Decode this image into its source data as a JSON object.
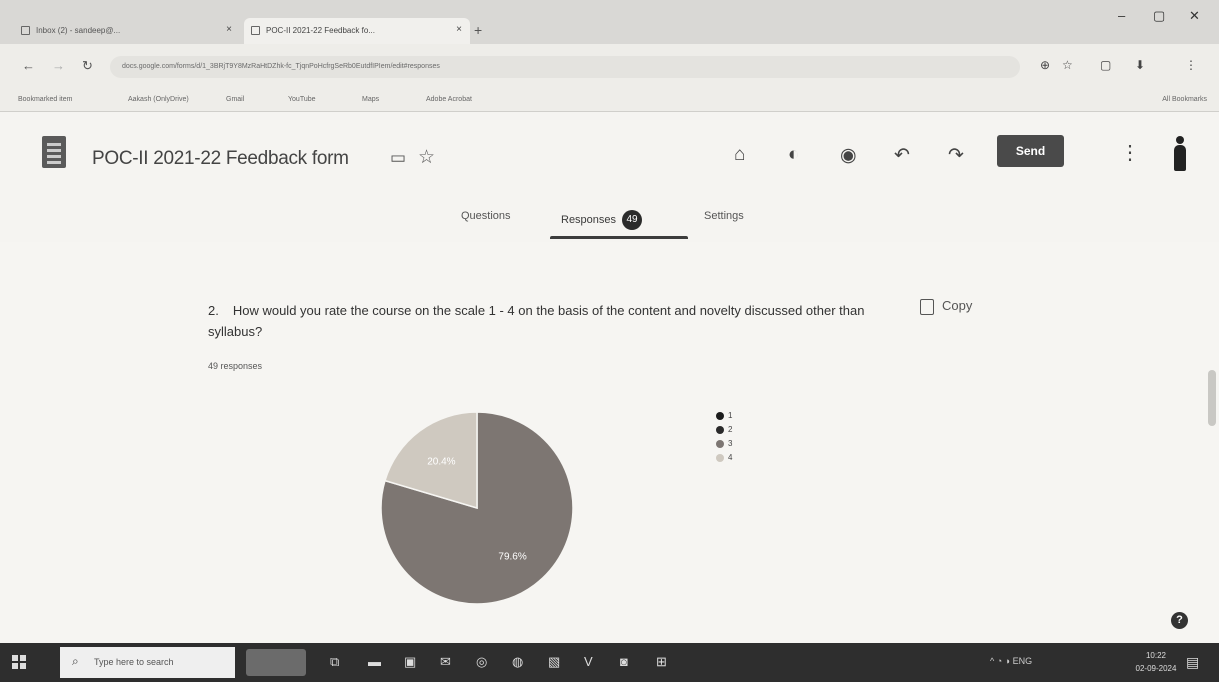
{
  "browser": {
    "tabs": [
      {
        "title": "Inbox (2) - sandeep@...",
        "close": "×"
      },
      {
        "title": "POC-II 2021-22 Feedback fo...",
        "close": "×"
      }
    ],
    "new_tab": "+",
    "window_controls": {
      "minimize": "–",
      "maximize": "▢",
      "close": "✕"
    },
    "nav": {
      "back": "←",
      "forward": "→",
      "reload": "↻"
    },
    "address": "docs.google.com/forms/d/1_3BRjT9Y8MzRaHtDZhk-fc_TjqnPoHcfrgSeRb0EutdfIPIem/edit#responses",
    "bookmarks": [
      "Bookmarked item",
      "Aakash (OnlyDrive)",
      "Gmail",
      "YouTube",
      "Maps",
      "Adobe Acrobat"
    ],
    "bookmarks_all": "All Bookmarks"
  },
  "form": {
    "title": "POC-II 2021-22 Feedback form",
    "send_label": "Send",
    "tabs": {
      "questions": "Questions",
      "responses": "Responses",
      "response_count": "49",
      "settings": "Settings"
    }
  },
  "question": {
    "number": "2.",
    "text": "How would you rate the course on the scale 1 - 4 on the basis of the content and novelty discussed other than syllabus?",
    "copy_label": "Copy",
    "responses_label": "49 responses"
  },
  "chart_data": {
    "type": "pie",
    "title": "",
    "categories": [
      "1",
      "2",
      "3",
      "4"
    ],
    "values": [
      0,
      0,
      79.6,
      20.4
    ],
    "data_labels": [
      "",
      "",
      "79.6%",
      "20.4%"
    ],
    "colors": [
      "#1c1c1c",
      "#2a2a2a",
      "#7d7672",
      "#cfc9c0"
    ],
    "legend_position": "right"
  },
  "taskbar": {
    "search_placeholder": "Type here to search",
    "tray_text": "^ ◔ ◑ ENG",
    "time": "10:22",
    "date": "02-09-2024"
  }
}
